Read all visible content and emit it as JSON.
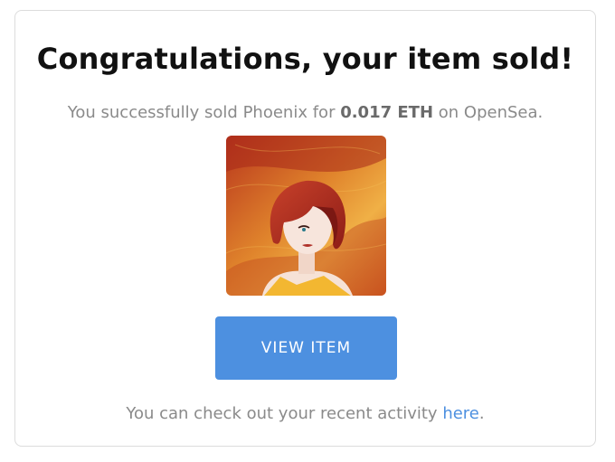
{
  "heading": "Congratulations, your item sold!",
  "sale": {
    "prefix": "You successfully sold Phoenix for ",
    "price": "0.017 ETH",
    "suffix": " on OpenSea."
  },
  "item_image": {
    "alt": "Phoenix"
  },
  "button": {
    "label": "VIEW ITEM"
  },
  "footer": {
    "prefix": "You can check out your recent activity ",
    "link": "here",
    "suffix": "."
  },
  "colors": {
    "accent": "#4d90e0"
  }
}
